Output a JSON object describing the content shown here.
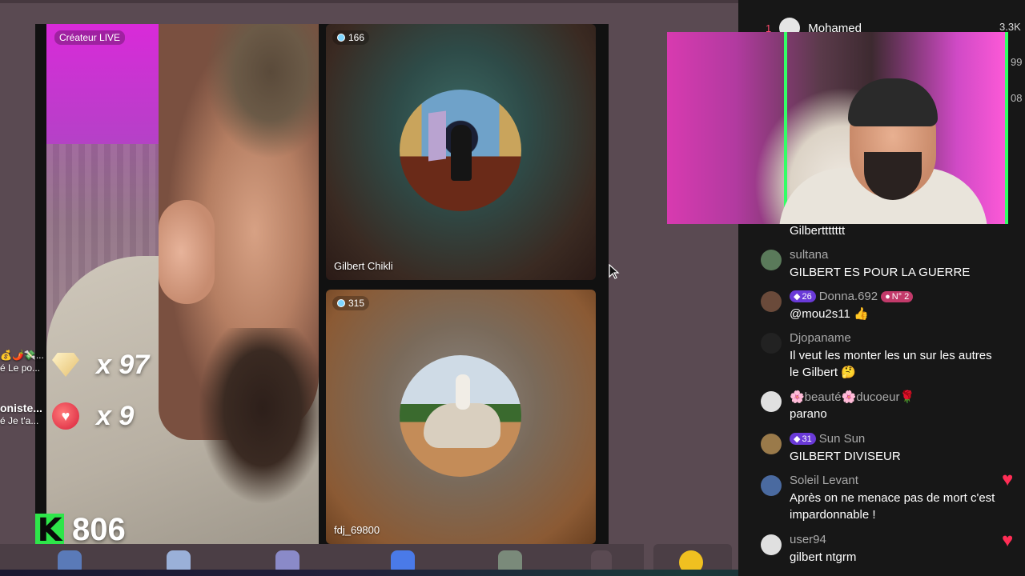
{
  "grid": {
    "host_label": "Créateur LIVE",
    "guests": [
      {
        "viewers": "166",
        "name": "Gilbert Chikli"
      },
      {
        "viewers": "315",
        "name": "fdj_69800"
      }
    ]
  },
  "gifts": [
    {
      "icon": "diamond-icon",
      "count": "x 97"
    },
    {
      "icon": "heart-face-icon",
      "count": "x 9"
    }
  ],
  "side_chips": [
    {
      "line1": "💰🌶️💸...",
      "line2": "é Le po..."
    },
    {
      "line1": "oniste...",
      "line2": "é Je t'a..."
    }
  ],
  "score": {
    "logo": "K",
    "value": "806"
  },
  "leaderboard": [
    {
      "rank": "1",
      "name": "Mohamed",
      "value": "3.3K"
    },
    {
      "value": "99"
    },
    {
      "value": "08"
    }
  ],
  "chat": [
    {
      "user": "",
      "text": "Gilberttttttt",
      "avatar_color": "#555555"
    },
    {
      "user": "sultana",
      "text": "GILBERT ES POUR LA GUERRE",
      "avatar_color": "#5a7a5a"
    },
    {
      "user": "Donna.692",
      "badge": "26",
      "extra_badge": "N° 2",
      "text": "@mou2s11 👍",
      "avatar_color": "#6a4a3a"
    },
    {
      "user": "Djopaname",
      "text": "Il veut les monter les un sur les autres le Gilbert 🤔",
      "avatar_color": "#222222"
    },
    {
      "user": "🌸beauté🌸ducoeur🌹",
      "text": "parano",
      "avatar_color": "#e0e0e0"
    },
    {
      "user": "Sun Sun",
      "badge": "31",
      "text": "GILBERT DIVISEUR",
      "avatar_color": "#9a7a4a"
    },
    {
      "user": "Soleil Levant",
      "text": "Après on ne menace pas de mort c'est impardonnable !",
      "avatar_color": "#4a6aa0"
    },
    {
      "user": "user94",
      "text": "gilbert ntgrm",
      "avatar_color": "#e0e0e0"
    }
  ],
  "colors": {
    "chat_bg": "#171717",
    "heart": "#ff2d55",
    "badge_purple": "#6a3ad8",
    "k_green": "#2ee64a"
  }
}
